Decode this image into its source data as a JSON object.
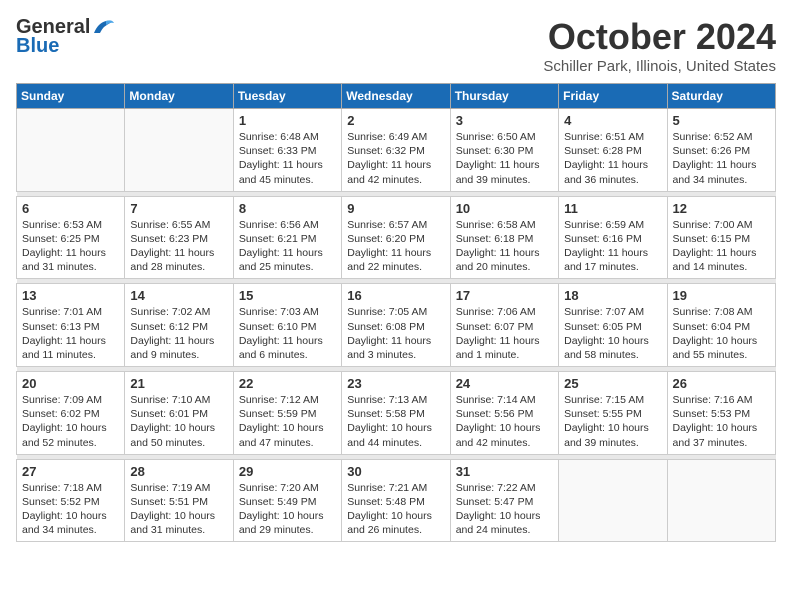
{
  "header": {
    "logo_general": "General",
    "logo_blue": "Blue",
    "month_title": "October 2024",
    "location": "Schiller Park, Illinois, United States"
  },
  "weekdays": [
    "Sunday",
    "Monday",
    "Tuesday",
    "Wednesday",
    "Thursday",
    "Friday",
    "Saturday"
  ],
  "weeks": [
    [
      {
        "day": "",
        "sunrise": "",
        "sunset": "",
        "daylight": ""
      },
      {
        "day": "",
        "sunrise": "",
        "sunset": "",
        "daylight": ""
      },
      {
        "day": "1",
        "sunrise": "Sunrise: 6:48 AM",
        "sunset": "Sunset: 6:33 PM",
        "daylight": "Daylight: 11 hours and 45 minutes."
      },
      {
        "day": "2",
        "sunrise": "Sunrise: 6:49 AM",
        "sunset": "Sunset: 6:32 PM",
        "daylight": "Daylight: 11 hours and 42 minutes."
      },
      {
        "day": "3",
        "sunrise": "Sunrise: 6:50 AM",
        "sunset": "Sunset: 6:30 PM",
        "daylight": "Daylight: 11 hours and 39 minutes."
      },
      {
        "day": "4",
        "sunrise": "Sunrise: 6:51 AM",
        "sunset": "Sunset: 6:28 PM",
        "daylight": "Daylight: 11 hours and 36 minutes."
      },
      {
        "day": "5",
        "sunrise": "Sunrise: 6:52 AM",
        "sunset": "Sunset: 6:26 PM",
        "daylight": "Daylight: 11 hours and 34 minutes."
      }
    ],
    [
      {
        "day": "6",
        "sunrise": "Sunrise: 6:53 AM",
        "sunset": "Sunset: 6:25 PM",
        "daylight": "Daylight: 11 hours and 31 minutes."
      },
      {
        "day": "7",
        "sunrise": "Sunrise: 6:55 AM",
        "sunset": "Sunset: 6:23 PM",
        "daylight": "Daylight: 11 hours and 28 minutes."
      },
      {
        "day": "8",
        "sunrise": "Sunrise: 6:56 AM",
        "sunset": "Sunset: 6:21 PM",
        "daylight": "Daylight: 11 hours and 25 minutes."
      },
      {
        "day": "9",
        "sunrise": "Sunrise: 6:57 AM",
        "sunset": "Sunset: 6:20 PM",
        "daylight": "Daylight: 11 hours and 22 minutes."
      },
      {
        "day": "10",
        "sunrise": "Sunrise: 6:58 AM",
        "sunset": "Sunset: 6:18 PM",
        "daylight": "Daylight: 11 hours and 20 minutes."
      },
      {
        "day": "11",
        "sunrise": "Sunrise: 6:59 AM",
        "sunset": "Sunset: 6:16 PM",
        "daylight": "Daylight: 11 hours and 17 minutes."
      },
      {
        "day": "12",
        "sunrise": "Sunrise: 7:00 AM",
        "sunset": "Sunset: 6:15 PM",
        "daylight": "Daylight: 11 hours and 14 minutes."
      }
    ],
    [
      {
        "day": "13",
        "sunrise": "Sunrise: 7:01 AM",
        "sunset": "Sunset: 6:13 PM",
        "daylight": "Daylight: 11 hours and 11 minutes."
      },
      {
        "day": "14",
        "sunrise": "Sunrise: 7:02 AM",
        "sunset": "Sunset: 6:12 PM",
        "daylight": "Daylight: 11 hours and 9 minutes."
      },
      {
        "day": "15",
        "sunrise": "Sunrise: 7:03 AM",
        "sunset": "Sunset: 6:10 PM",
        "daylight": "Daylight: 11 hours and 6 minutes."
      },
      {
        "day": "16",
        "sunrise": "Sunrise: 7:05 AM",
        "sunset": "Sunset: 6:08 PM",
        "daylight": "Daylight: 11 hours and 3 minutes."
      },
      {
        "day": "17",
        "sunrise": "Sunrise: 7:06 AM",
        "sunset": "Sunset: 6:07 PM",
        "daylight": "Daylight: 11 hours and 1 minute."
      },
      {
        "day": "18",
        "sunrise": "Sunrise: 7:07 AM",
        "sunset": "Sunset: 6:05 PM",
        "daylight": "Daylight: 10 hours and 58 minutes."
      },
      {
        "day": "19",
        "sunrise": "Sunrise: 7:08 AM",
        "sunset": "Sunset: 6:04 PM",
        "daylight": "Daylight: 10 hours and 55 minutes."
      }
    ],
    [
      {
        "day": "20",
        "sunrise": "Sunrise: 7:09 AM",
        "sunset": "Sunset: 6:02 PM",
        "daylight": "Daylight: 10 hours and 52 minutes."
      },
      {
        "day": "21",
        "sunrise": "Sunrise: 7:10 AM",
        "sunset": "Sunset: 6:01 PM",
        "daylight": "Daylight: 10 hours and 50 minutes."
      },
      {
        "day": "22",
        "sunrise": "Sunrise: 7:12 AM",
        "sunset": "Sunset: 5:59 PM",
        "daylight": "Daylight: 10 hours and 47 minutes."
      },
      {
        "day": "23",
        "sunrise": "Sunrise: 7:13 AM",
        "sunset": "Sunset: 5:58 PM",
        "daylight": "Daylight: 10 hours and 44 minutes."
      },
      {
        "day": "24",
        "sunrise": "Sunrise: 7:14 AM",
        "sunset": "Sunset: 5:56 PM",
        "daylight": "Daylight: 10 hours and 42 minutes."
      },
      {
        "day": "25",
        "sunrise": "Sunrise: 7:15 AM",
        "sunset": "Sunset: 5:55 PM",
        "daylight": "Daylight: 10 hours and 39 minutes."
      },
      {
        "day": "26",
        "sunrise": "Sunrise: 7:16 AM",
        "sunset": "Sunset: 5:53 PM",
        "daylight": "Daylight: 10 hours and 37 minutes."
      }
    ],
    [
      {
        "day": "27",
        "sunrise": "Sunrise: 7:18 AM",
        "sunset": "Sunset: 5:52 PM",
        "daylight": "Daylight: 10 hours and 34 minutes."
      },
      {
        "day": "28",
        "sunrise": "Sunrise: 7:19 AM",
        "sunset": "Sunset: 5:51 PM",
        "daylight": "Daylight: 10 hours and 31 minutes."
      },
      {
        "day": "29",
        "sunrise": "Sunrise: 7:20 AM",
        "sunset": "Sunset: 5:49 PM",
        "daylight": "Daylight: 10 hours and 29 minutes."
      },
      {
        "day": "30",
        "sunrise": "Sunrise: 7:21 AM",
        "sunset": "Sunset: 5:48 PM",
        "daylight": "Daylight: 10 hours and 26 minutes."
      },
      {
        "day": "31",
        "sunrise": "Sunrise: 7:22 AM",
        "sunset": "Sunset: 5:47 PM",
        "daylight": "Daylight: 10 hours and 24 minutes."
      },
      {
        "day": "",
        "sunrise": "",
        "sunset": "",
        "daylight": ""
      },
      {
        "day": "",
        "sunrise": "",
        "sunset": "",
        "daylight": ""
      }
    ]
  ]
}
